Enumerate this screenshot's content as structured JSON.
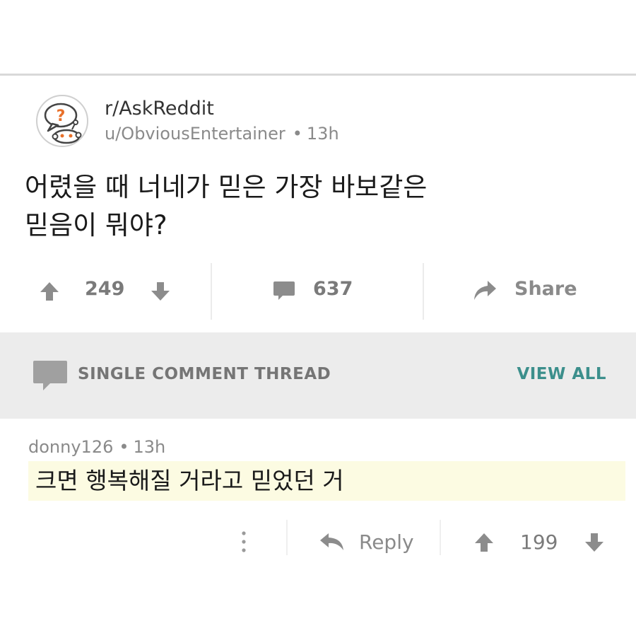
{
  "post": {
    "subreddit": "r/AskReddit",
    "author": "u/ObviousEntertainer",
    "age": "13h",
    "title_line1": "어렸을 때 너네가 믿은 가장 바보같은",
    "title_line2": "믿음이 뭐야?",
    "upvotes": "249",
    "comments": "637",
    "share_label": "Share"
  },
  "thread": {
    "label": "SINGLE COMMENT THREAD",
    "view_all_label": "VIEW ALL"
  },
  "comment": {
    "author": "donny126",
    "age": "13h",
    "text": "크면 행복해질 거라고 믿었던 거",
    "reply_label": "Reply",
    "votes": "199"
  },
  "icons": {
    "avatar": "reddit-question-avatar-icon",
    "upvote": "arrow-up-icon",
    "downvote": "arrow-down-icon",
    "comment": "speech-bubble-icon",
    "share": "share-arrow-icon",
    "more": "vertical-dots-icon",
    "reply": "reply-arrow-icon"
  },
  "colors": {
    "accent": "#3c8f8c",
    "highlight": "#fcfbe2",
    "thread_bar": "#ececec",
    "muted_text": "#8a8a8a"
  }
}
